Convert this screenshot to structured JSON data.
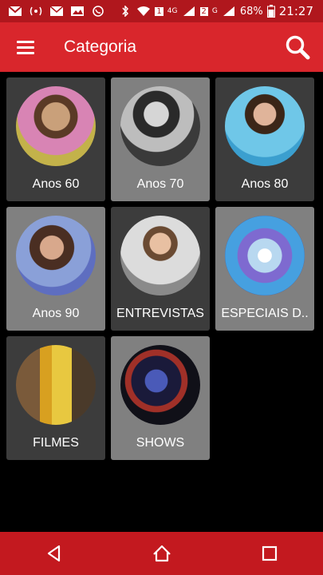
{
  "status": {
    "signal_labels": [
      "1",
      "4G",
      "2",
      "G"
    ],
    "battery": "68%",
    "time": "21:27"
  },
  "appbar": {
    "title": "Categoria"
  },
  "categories": [
    {
      "label": "Anos 60",
      "shade": "dark"
    },
    {
      "label": "Anos 70",
      "shade": "light"
    },
    {
      "label": "Anos 80",
      "shade": "dark"
    },
    {
      "label": "Anos 90",
      "shade": "light"
    },
    {
      "label": "ENTREVISTAS",
      "shade": "dark"
    },
    {
      "label": "ESPECIAIS D..",
      "shade": "light"
    },
    {
      "label": "FILMES",
      "shade": "dark"
    },
    {
      "label": "SHOWS",
      "shade": "light"
    }
  ],
  "colors": {
    "statusbar": "#b0171d",
    "appbar": "#d9262c",
    "navbar": "#c3191f",
    "tile_dark": "#3c3c3c",
    "tile_light": "#808080"
  }
}
